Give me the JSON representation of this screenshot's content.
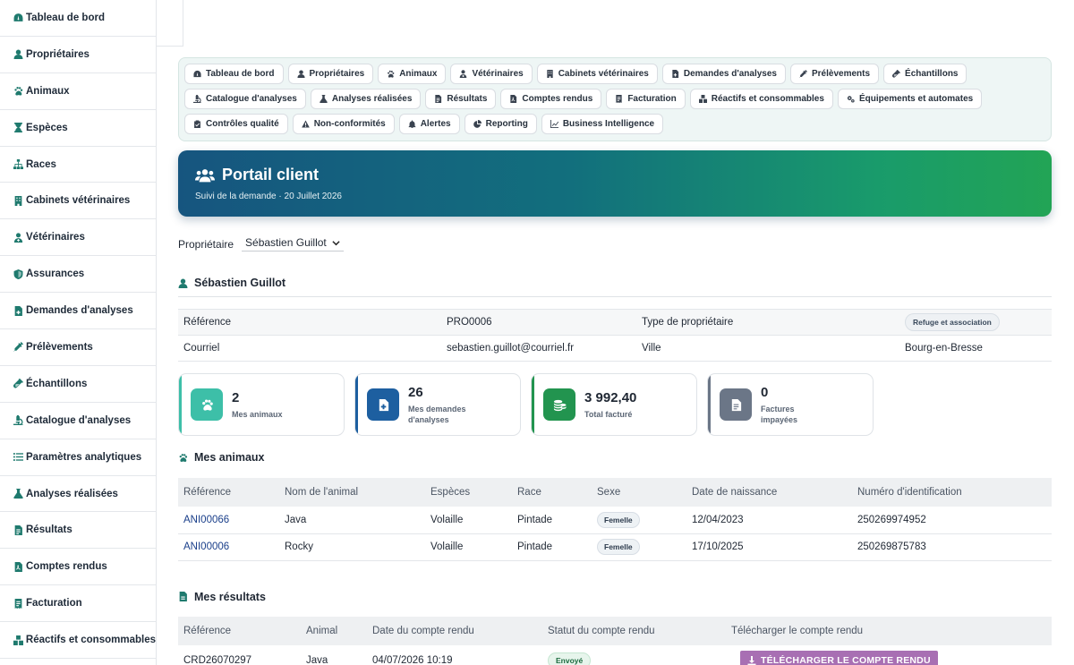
{
  "sidebar": {
    "items": [
      {
        "label": "Tableau de bord",
        "icon": "dashboard-icon"
      },
      {
        "label": "Propriétaires",
        "icon": "user-icon"
      },
      {
        "label": "Animaux",
        "icon": "paw-icon"
      },
      {
        "label": "Espèces",
        "icon": "hourglass-icon"
      },
      {
        "label": "Races",
        "icon": "sitemap-icon"
      },
      {
        "label": "Cabinets vétérinaires",
        "icon": "building-icon"
      },
      {
        "label": "Vétérinaires",
        "icon": "user-doctor-icon"
      },
      {
        "label": "Assurances",
        "icon": "shield-icon"
      },
      {
        "label": "Demandes d'analyses",
        "icon": "file-medical-icon"
      },
      {
        "label": "Prélèvements",
        "icon": "syringe-icon"
      },
      {
        "label": "Échantillons",
        "icon": "vial-icon"
      },
      {
        "label": "Catalogue d'analyses",
        "icon": "microscope-icon"
      },
      {
        "label": "Paramètres analytiques",
        "icon": "list-icon"
      },
      {
        "label": "Analyses réalisées",
        "icon": "flask-icon"
      },
      {
        "label": "Résultats",
        "icon": "file-result-icon"
      },
      {
        "label": "Comptes rendus",
        "icon": "file-pdf-icon"
      },
      {
        "label": "Facturation",
        "icon": "invoice-icon"
      },
      {
        "label": "Réactifs et consommables",
        "icon": "boxes-icon"
      }
    ]
  },
  "quicknav": [
    {
      "label": "Tableau de bord"
    },
    {
      "label": "Propriétaires"
    },
    {
      "label": "Animaux"
    },
    {
      "label": "Vétérinaires"
    },
    {
      "label": "Cabinets vétérinaires"
    },
    {
      "label": "Demandes d'analyses"
    },
    {
      "label": "Prélèvements"
    },
    {
      "label": "Échantillons"
    },
    {
      "label": "Catalogue d'analyses"
    },
    {
      "label": "Analyses réalisées"
    },
    {
      "label": "Résultats"
    },
    {
      "label": "Comptes rendus"
    },
    {
      "label": "Facturation"
    },
    {
      "label": "Réactifs et consommables"
    },
    {
      "label": "Équipements et automates"
    },
    {
      "label": "Contrôles qualité"
    },
    {
      "label": "Non-conformités"
    },
    {
      "label": "Alertes"
    },
    {
      "label": "Reporting"
    },
    {
      "label": "Business Intelligence"
    }
  ],
  "hero": {
    "title": "Portail client",
    "subtitle": "Suivi de la demande · 20 Juillet 2026"
  },
  "owner_select": {
    "label": "Propriétaire",
    "value": "Sébastien Guillot"
  },
  "owner": {
    "name": "Sébastien Guillot",
    "ref_label": "Référence",
    "ref_value": "PRO0006",
    "type_label": "Type de propriétaire",
    "type_value": "Refuge et association",
    "email_label": "Courriel",
    "email_value": "sebastien.guillot@courriel.fr",
    "city_label": "Ville",
    "city_value": "Bourg-en-Bresse"
  },
  "stats": [
    {
      "value": "2",
      "label": "Mes animaux",
      "color": "#3dbfa8",
      "bar": "#3dbfa8"
    },
    {
      "value": "26",
      "label": "Mes demandes d'analyses",
      "color": "#1d5fa0",
      "bar": "#1d5fa0"
    },
    {
      "value": "3 992,40",
      "label": "Total facturé",
      "color": "#22944f",
      "bar": "#22944f"
    },
    {
      "value": "0",
      "label": "Factures impayées",
      "color": "#6b7687",
      "bar": "#6b7687"
    }
  ],
  "animals": {
    "title": "Mes animaux",
    "columns": [
      "Référence",
      "Nom de l'animal",
      "Espèces",
      "Race",
      "Sexe",
      "Date de naissance",
      "Numéro d'identification"
    ],
    "rows": [
      {
        "ref": "ANI00066",
        "name": "Java",
        "species": "Volaille",
        "breed": "Pintade",
        "sex": "Femelle",
        "birth": "12/04/2023",
        "id": "250269974952"
      },
      {
        "ref": "ANI00006",
        "name": "Rocky",
        "species": "Volaille",
        "breed": "Pintade",
        "sex": "Femelle",
        "birth": "17/10/2025",
        "id": "250269875783"
      }
    ]
  },
  "results": {
    "title": "Mes résultats",
    "columns": [
      "Référence",
      "Animal",
      "Date du compte rendu",
      "Statut du compte rendu",
      "Télécharger le compte rendu"
    ],
    "rows": [
      {
        "ref": "CRD26070297",
        "animal": "Java",
        "date": "04/07/2026 10:19",
        "status": "Envoyé",
        "download": "TÉLÉCHARGER LE COMPTE RENDU"
      }
    ]
  }
}
